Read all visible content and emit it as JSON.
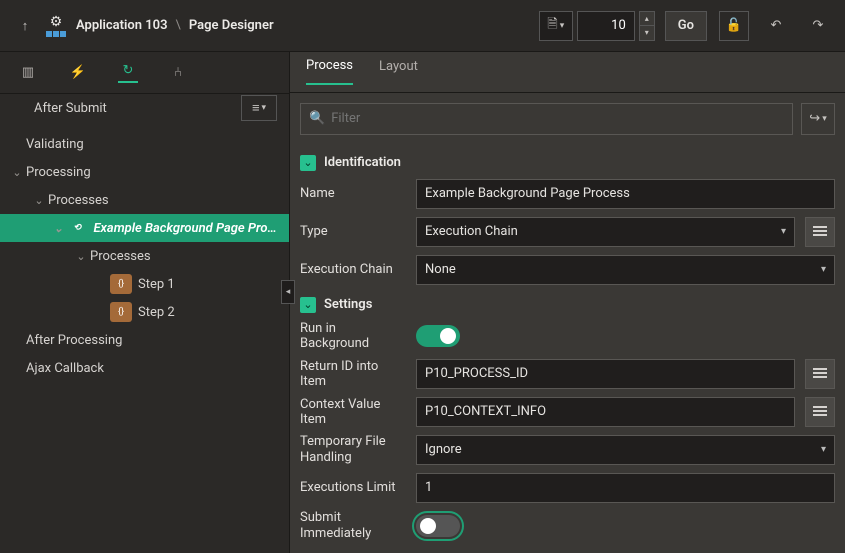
{
  "header": {
    "app_label": "Application 103",
    "page_designer_label": "Page Designer",
    "separator": "\\",
    "page_number": "10",
    "go_label": "Go"
  },
  "tree": {
    "after_submit": "After Submit",
    "validating": "Validating",
    "processing": "Processing",
    "processes": "Processes",
    "selected": "Example Background Page Process",
    "child_processes": "Processes",
    "step1": "Step 1",
    "step2": "Step 2",
    "after_processing": "After Processing",
    "ajax_callback": "Ajax Callback"
  },
  "right": {
    "tab_process": "Process",
    "tab_layout": "Layout",
    "filter_placeholder": "Filter"
  },
  "sections": {
    "identification": {
      "title": "Identification",
      "name_label": "Name",
      "name_value": "Example Background Page Process",
      "type_label": "Type",
      "type_value": "Execution Chain",
      "chain_label": "Execution Chain",
      "chain_value": "None"
    },
    "settings": {
      "title": "Settings",
      "run_bg_label": "Run in Background",
      "run_bg_value": true,
      "return_id_label": "Return ID into Item",
      "return_id_value": "P10_PROCESS_ID",
      "context_label": "Context Value Item",
      "context_value": "P10_CONTEXT_INFO",
      "tmpfile_label": "Temporary File Handling",
      "tmpfile_value": "Ignore",
      "exec_limit_label": "Executions Limit",
      "exec_limit_value": "1",
      "submit_immediately_label": "Submit Immediately",
      "submit_immediately_value": false
    }
  }
}
